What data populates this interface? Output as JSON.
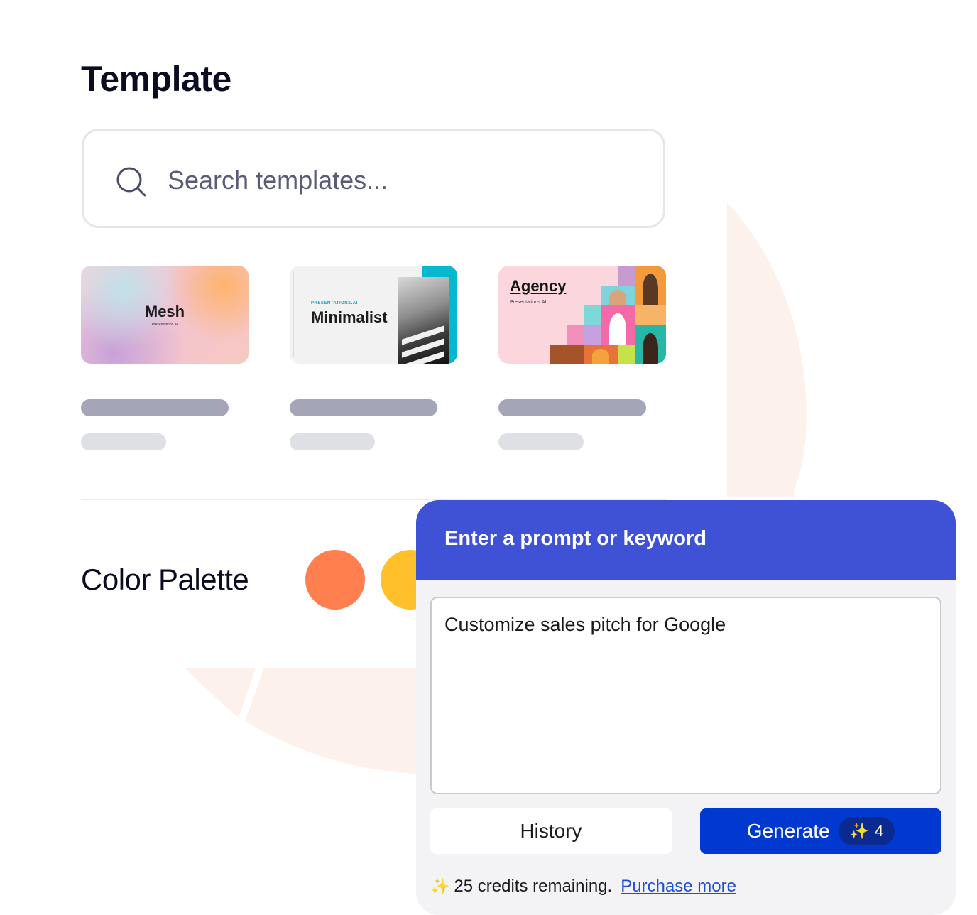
{
  "template": {
    "title": "Template",
    "search_placeholder": "Search templates...",
    "cards": [
      {
        "name": "Mesh",
        "subtitle": "Presentations.AI"
      },
      {
        "name": "Minimalist",
        "tag": "PRESENTATIONS.AI"
      },
      {
        "name": "Agency",
        "subtitle": "Presentations.AI"
      }
    ]
  },
  "palette": {
    "title": "Color Palette",
    "swatches": [
      "#ff7f4f",
      "#ffc02a"
    ]
  },
  "prompt_panel": {
    "header": "Enter a prompt or keyword",
    "prompt_value": "Customize sales pitch for Google",
    "history_label": "History",
    "generate_label": "Generate",
    "generate_cost": "4",
    "credits_text": "25 credits remaining.",
    "purchase_link": "Purchase more"
  },
  "colors": {
    "accent": "#3f52d6",
    "button_primary": "#0138cf",
    "decor": "#fdf1ec"
  },
  "icons": {
    "search": "search-icon",
    "sparkle": "sparkle-icon"
  }
}
